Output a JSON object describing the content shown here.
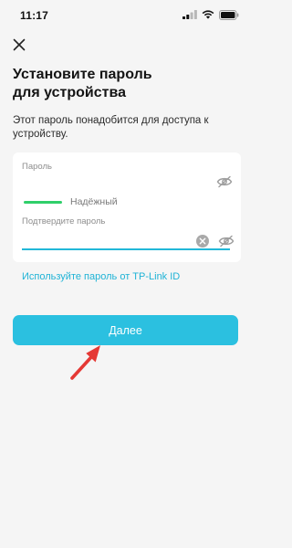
{
  "status_bar": {
    "time": "11:17",
    "icons": [
      "signal-icon",
      "wifi-icon",
      "battery-icon"
    ]
  },
  "header": {
    "close_icon": "close-icon"
  },
  "title": {
    "line1": "Установите пароль",
    "line2": "для устройства"
  },
  "subtitle": {
    "line1": "Этот пароль понадобится для доступа к",
    "line2": "устройству."
  },
  "password_field": {
    "label": "Пароль",
    "value": "",
    "strength_label": "Надёжный",
    "strength_level": "strong",
    "strength_color": "#2fcf6a"
  },
  "confirm_field": {
    "label": "Подтвердите пароль",
    "value": ""
  },
  "tplink_link": {
    "label": "Используйте пароль от TP-Link ID"
  },
  "next_button": {
    "label": "Далее"
  },
  "colors": {
    "accent": "#2bc0e0",
    "link": "#1fb3d6",
    "strength": "#2fcf6a",
    "annotation": "#e53935",
    "background": "#f5f5f5"
  }
}
